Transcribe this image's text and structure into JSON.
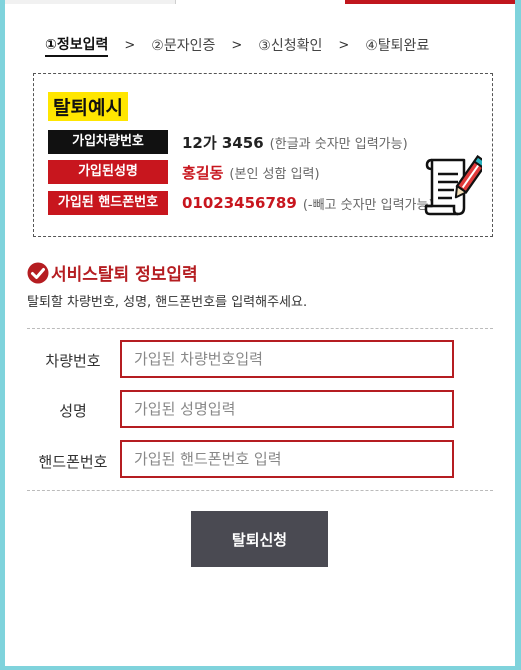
{
  "steps": [
    {
      "label": "①정보입력"
    },
    {
      "label": "②문자인증"
    },
    {
      "label": "③신청확인"
    },
    {
      "label": "④탈퇴완료"
    }
  ],
  "step_separator": ">",
  "example": {
    "title": "탈퇴예시",
    "rows": [
      {
        "label": "가입차량번호",
        "value": "12가 3456",
        "note": "(한글과 숫자만 입력가능)"
      },
      {
        "label": "가입된성명",
        "value": "홍길동",
        "note": "(본인 성함 입력)"
      },
      {
        "label": "가입된 핸드폰번호",
        "value": "01023456789",
        "note": "(-빼고 숫자만 입력가능)"
      }
    ],
    "icon": "document-pencil-icon"
  },
  "section": {
    "title": "서비스탈퇴 정보입력",
    "description": "탈퇴할 차량번호, 성명, 핸드폰번호를 입력해주세요.",
    "icon": "check-circle-icon"
  },
  "form": {
    "car_label": "차량번호",
    "car_placeholder": "가입된 차량번호입력",
    "name_label": "성명",
    "name_placeholder": "가입된 성명입력",
    "phone_label": "핸드폰번호",
    "phone_placeholder": "가입된 핸드폰번호 입력",
    "submit_label": "탈퇴신청"
  },
  "colors": {
    "accent": "#b51d21",
    "highlight": "#ffe600",
    "button": "#4a4a52",
    "background": "#7fd3dc"
  }
}
